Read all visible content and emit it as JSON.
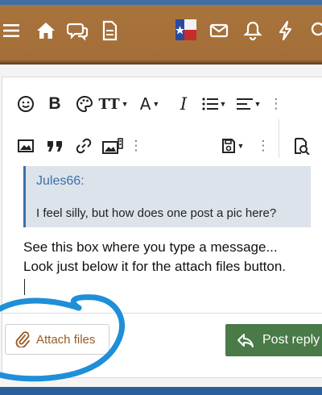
{
  "header": {
    "nav_icons": [
      "menu-icon",
      "home-icon",
      "chat-icon",
      "document-icon",
      "avatar-icon",
      "mail-icon",
      "bell-icon",
      "flash-icon",
      "search-icon"
    ]
  },
  "toolbar": {
    "row1": [
      "smiley-icon",
      "bold-icon",
      "palette-icon",
      "text-size-icon",
      "font-color-icon",
      "italic-icon",
      "list-icon",
      "align-icon",
      "more-icon"
    ],
    "row2": [
      "image-icon",
      "quote-icon",
      "link-icon",
      "media-icon",
      "more-icon",
      "save-draft-icon",
      "more-icon",
      "preview-icon"
    ],
    "bold_glyph": "B",
    "italic_glyph": "I",
    "textsize_glyph": "TT",
    "fontcolor_glyph": "A"
  },
  "quote": {
    "author": "Jules66:",
    "text": "I feel silly, but how does one post a pic here?"
  },
  "message": {
    "line1": "See this box where you type a message...",
    "line2": "Look just below it for the attach files button."
  },
  "buttons": {
    "attach": "Attach files",
    "post_reply": "Post reply"
  },
  "colors": {
    "header": "#a46e37",
    "quote_accent": "#3b6fab",
    "post_button": "#4a7a47",
    "annotation": "#1e8fd8"
  }
}
